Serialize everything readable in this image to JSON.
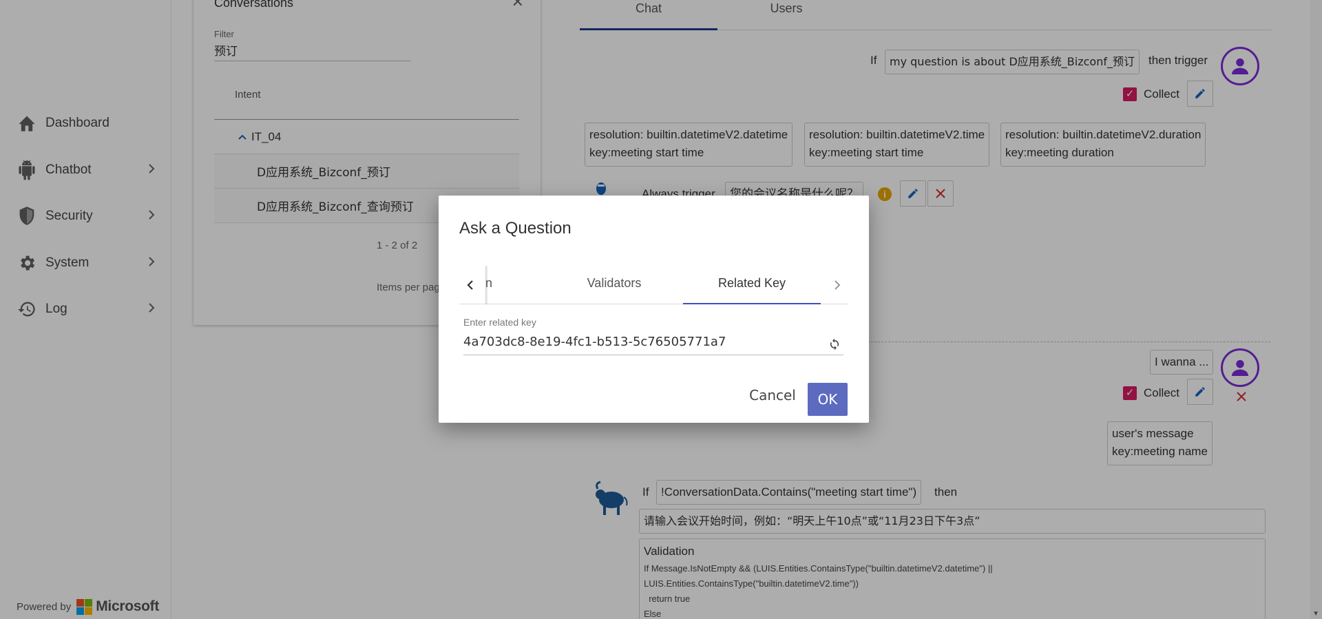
{
  "sidebar": {
    "items": [
      {
        "label": "Dashboard",
        "icon": "home-icon"
      },
      {
        "label": "Chatbot",
        "icon": "android-icon"
      },
      {
        "label": "Security",
        "icon": "shield-icon"
      },
      {
        "label": "System",
        "icon": "gear-icon"
      },
      {
        "label": "Log",
        "icon": "history-icon"
      }
    ],
    "powered_by": "Powered by",
    "brand": "Microsoft"
  },
  "conversations": {
    "title": "Conversations",
    "filter_label": "Filter",
    "filter_value": "预订",
    "column_header": "Intent",
    "group": "IT_04",
    "intents": [
      "D应用系统_Bizconf_预订",
      "D应用系统_Bizconf_查询预订"
    ],
    "pager": "1 - 2 of 2",
    "items_per_page": "Items per page"
  },
  "chat": {
    "tabs": [
      "Chat",
      "Users"
    ],
    "if1": "If",
    "cond1": "my question is about D应用系统_Bizconf_预订",
    "then_trigger": "then trigger",
    "collect": "Collect",
    "resolutions": [
      {
        "line1": "resolution: builtin.datetimeV2.datetime",
        "line2": "key:meeting start time"
      },
      {
        "line1": "resolution: builtin.datetimeV2.time",
        "line2": "key:meeting start time"
      },
      {
        "line1": "resolution: builtin.datetimeV2.duration",
        "line2": "key:meeting duration"
      }
    ],
    "always_trigger": "Always trigger",
    "always_question": "您的会议名称是什么呢？",
    "wanna": "I wanna ...",
    "collect2": "Collect",
    "user_msg_line1": "user's message",
    "user_msg_line2": "key:meeting name",
    "if2": "If",
    "cond2": "!ConversationData.Contains(\"meeting start time\")",
    "then": "then",
    "prompt": "请输入会议开始时间，例如：“明天上午10点”或“11月23日下午3点”",
    "validation_title": "Validation",
    "validation_code": "If Message.IsNotEmpty && (LUIS.Entities.ContainsType(\"builtin.datetimeV2.datetime\") ||\nLUIS.Entities.ContainsType(\"builtin.datetimeV2.time\"))\n  return true\nElse"
  },
  "dialog": {
    "title": "Ask a Question",
    "tab_partial": "n",
    "tabs": [
      "Validators",
      "Related Key"
    ],
    "active_tab": "Related Key",
    "field_label": "Enter related key",
    "field_value": "4a703dc8-8e19-4fc1-b513-5c76505771a7",
    "cancel": "Cancel",
    "ok": "OK"
  },
  "colors": {
    "accent": "#3f51b5",
    "ok_button": "#5c6bc0",
    "checkbox": "#d81b60",
    "avatar": "#7b2bd9",
    "edit_icon": "#1565c0",
    "delete_icon": "#d32f2f",
    "info_icon": "#e6a700"
  }
}
